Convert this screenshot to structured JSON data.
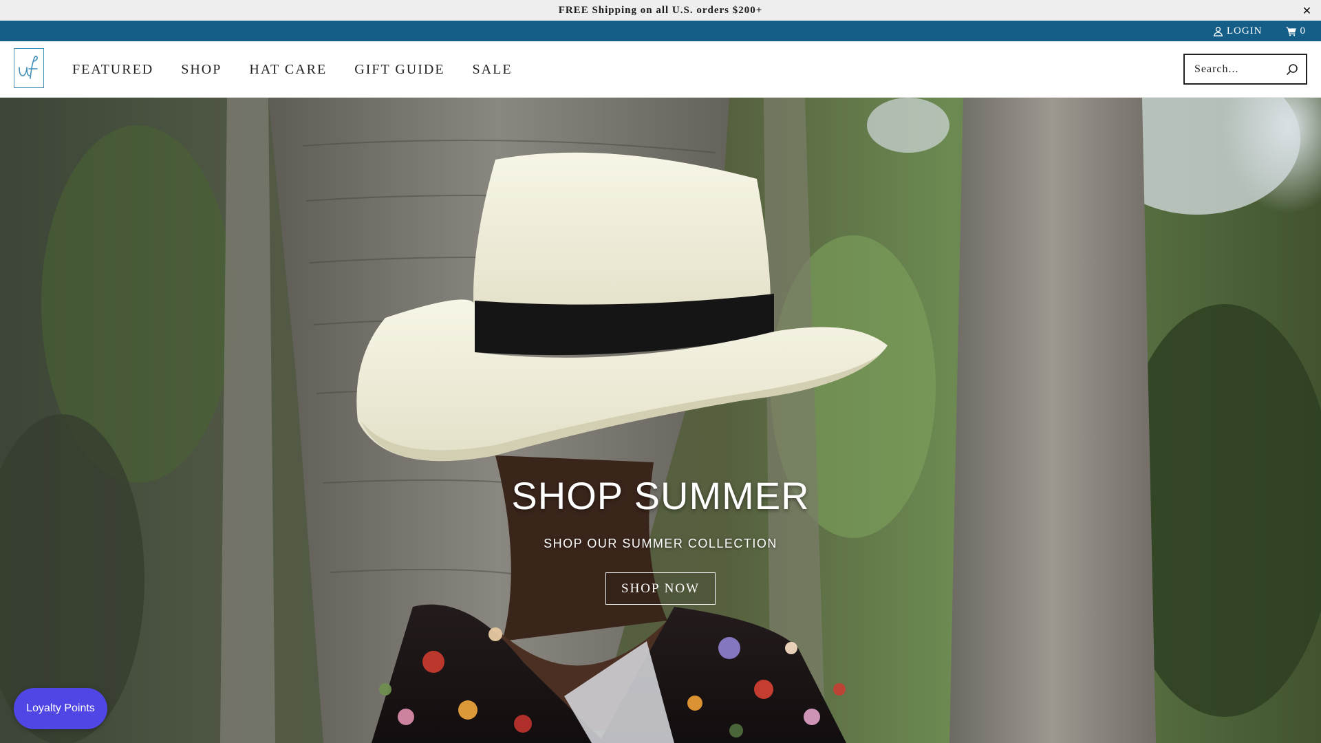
{
  "announcement": {
    "text": "FREE Shipping on all U.S. orders $200+",
    "close_glyph": "✕"
  },
  "utility_bar": {
    "login_label": "LOGIN",
    "login_icon": "user-icon",
    "cart_count": "0",
    "cart_icon": "cart-icon"
  },
  "header": {
    "logo_text": "uf",
    "nav": [
      "FEATURED",
      "SHOP",
      "HAT CARE",
      "GIFT GUIDE",
      "SALE"
    ],
    "search": {
      "placeholder": "Search...",
      "icon": "search-icon"
    }
  },
  "hero": {
    "title": "SHOP SUMMER",
    "subtitle": "SHOP OUR SUMMER COLLECTION",
    "cta_label": "SHOP NOW"
  },
  "loyalty": {
    "label": "Loyalty Points"
  },
  "colors": {
    "utility_bar": "#145e87",
    "announcement_bg": "#eeeeee",
    "loyalty_button": "#4f46e5",
    "logo_accent": "#3f8fb8"
  }
}
